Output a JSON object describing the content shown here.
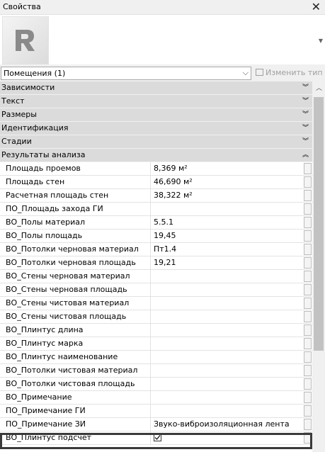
{
  "panel": {
    "title": "Свойства",
    "close_icon": "close-icon"
  },
  "type_selector": {
    "value": "Помещения (1)",
    "edit_type_label": "Изменить тип"
  },
  "categories": [
    {
      "label": "Зависимости",
      "state": "collapsed"
    },
    {
      "label": "Текст",
      "state": "collapsed"
    },
    {
      "label": "Размеры",
      "state": "collapsed"
    },
    {
      "label": "Идентификация",
      "state": "collapsed"
    },
    {
      "label": "Стадии",
      "state": "collapsed"
    },
    {
      "label": "Результаты анализа",
      "state": "expanded"
    }
  ],
  "properties": [
    {
      "name": "Площадь проемов",
      "value": "8,369 м²"
    },
    {
      "name": "Площадь стен",
      "value": "46,690 м²"
    },
    {
      "name": "Расчетная площадь стен",
      "value": "38,322 м²"
    },
    {
      "name": "ПО_Площадь захода ГИ",
      "value": ""
    },
    {
      "name": "ВО_Полы материал",
      "value": "5.5.1"
    },
    {
      "name": "ВО_Полы площадь",
      "value": "19,45"
    },
    {
      "name": "ВО_Потолки черновая материал",
      "value": "Пт1.4"
    },
    {
      "name": "ВО_Потолки черновая площадь",
      "value": "19,21"
    },
    {
      "name": "ВО_Стены черновая материал",
      "value": ""
    },
    {
      "name": "ВО_Стены черновая площадь",
      "value": ""
    },
    {
      "name": "ВО_Стены чистовая материал",
      "value": ""
    },
    {
      "name": "ВО_Стены чистовая площадь",
      "value": ""
    },
    {
      "name": "ВО_Плинтус длина",
      "value": ""
    },
    {
      "name": "ВО_Плинтус марка",
      "value": ""
    },
    {
      "name": "ВО_Плинтус наименование",
      "value": ""
    },
    {
      "name": "ВО_Потолки чистовая материал",
      "value": ""
    },
    {
      "name": "ВО_Потолки чистовая площадь",
      "value": ""
    },
    {
      "name": "ВО_Примечание",
      "value": ""
    },
    {
      "name": "ПО_Примечание ГИ",
      "value": ""
    },
    {
      "name": "ПО_Примечание ЗИ",
      "value": "Звуко-виброизоляционная лента"
    },
    {
      "name": "ВО_Плинтус подсчет",
      "value": "",
      "checkbox": true,
      "checked": true
    }
  ]
}
